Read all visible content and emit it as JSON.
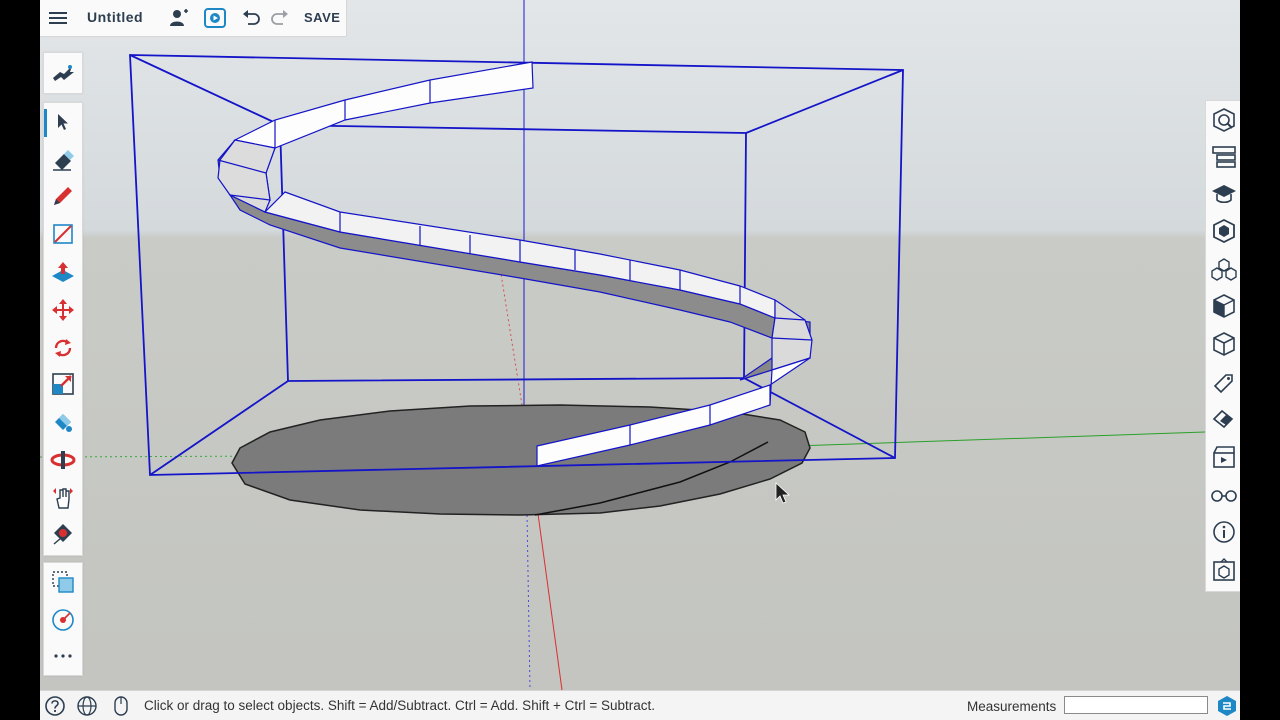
{
  "app": {
    "doc_title": "Untitled",
    "save_label": "SAVE"
  },
  "status": {
    "hint": "Click or drag to select objects. Shift = Add/Subtract. Ctrl = Add. Shift + Ctrl = Subtract.",
    "measurements_label": "Measurements",
    "measurements_value": ""
  },
  "colors": {
    "selection_blue": "#1414c8",
    "red_axis": "#d83030",
    "green_axis": "#2aa02a",
    "accent": "#1e88c7",
    "surface_gray": "#7b7b7b"
  },
  "tools": [
    "search-tool",
    "select-tool",
    "eraser-tool",
    "pencil-tool",
    "line-tool",
    "push-pull-tool",
    "move-tool",
    "rotate-tool",
    "scale-tool",
    "paint-bucket-tool",
    "orbit-tool",
    "pan-tool",
    "tape-measure-tool",
    "section-plane-tool",
    "3d-text-tool",
    "more-tools"
  ],
  "right_panel": [
    "entity-info",
    "outliner",
    "instructor",
    "components",
    "materials",
    "styles",
    "scenes",
    "tags",
    "soften-edges",
    "display",
    "views",
    "model-info",
    "solid-inspector"
  ]
}
